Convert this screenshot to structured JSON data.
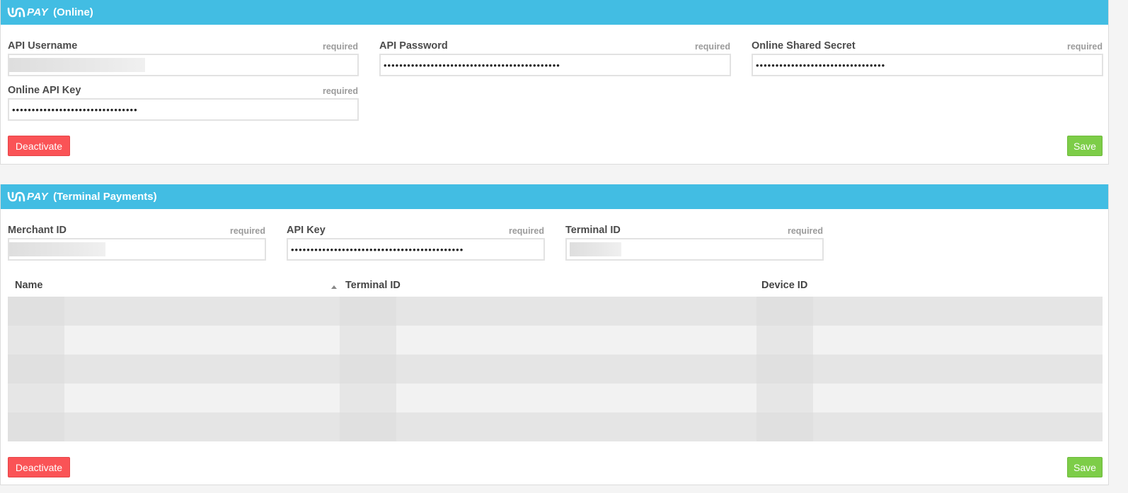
{
  "brand": {
    "logo_text": "PAY",
    "accent_color": "#42bde3"
  },
  "online": {
    "title": "(Online)",
    "fields": [
      {
        "label": "API Username",
        "required": "required",
        "value": "",
        "redacted": true
      },
      {
        "label": "API Password",
        "required": "required",
        "value": "•••••••••••••••••••••••••••••••••••••••••••••"
      },
      {
        "label": "Online Shared Secret",
        "required": "required",
        "value": "•••••••••••••••••••••••••••••••••"
      },
      {
        "label": "Online API Key",
        "required": "required",
        "value": "••••••••••••••••••••••••••••••••"
      }
    ],
    "deactivate_label": "Deactivate",
    "save_label": "Save"
  },
  "terminal": {
    "title": "(Terminal Payments)",
    "fields": [
      {
        "label": "Merchant ID",
        "required": "required",
        "value": "",
        "redacted": true
      },
      {
        "label": "API Key",
        "required": "required",
        "value": "••••••••••••••••••••••••••••••••••••••••••••"
      },
      {
        "label": "Terminal ID",
        "required": "required",
        "value": "",
        "redacted": true
      }
    ],
    "table": {
      "columns": [
        "Name",
        "Terminal ID",
        "Device ID"
      ],
      "sorted_column": "Name",
      "sort_direction": "ascending",
      "row_count": 5
    },
    "deactivate_label": "Deactivate",
    "save_label": "Save"
  },
  "colors": {
    "danger": "#fa5356",
    "success": "#7dcd48",
    "header": "#42bde3"
  }
}
